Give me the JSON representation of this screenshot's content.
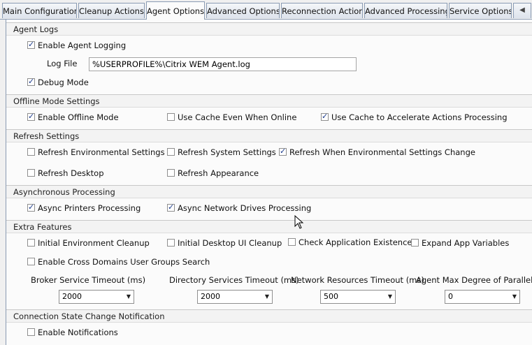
{
  "tabs": [
    {
      "label": "Main Configuration",
      "active": false
    },
    {
      "label": "Cleanup Actions",
      "active": false
    },
    {
      "label": "Agent Options",
      "active": true
    },
    {
      "label": "Advanced Options",
      "active": false
    },
    {
      "label": "Reconnection Actions",
      "active": false
    },
    {
      "label": "Advanced Processing",
      "active": false
    },
    {
      "label": "Service Options",
      "active": false
    }
  ],
  "tab_scroll_icon": "chevron-left-icon",
  "sections": {
    "agent_logs": {
      "title": "Agent Logs",
      "enable_agent_logging": {
        "label": "Enable Agent Logging",
        "checked": true
      },
      "log_file_label": "Log File",
      "log_file_value": "%USERPROFILE%\\Citrix WEM Agent.log",
      "debug_mode": {
        "label": "Debug Mode",
        "checked": true
      }
    },
    "offline_mode": {
      "title": "Offline Mode Settings",
      "enable_offline_mode": {
        "label": "Enable Offline Mode",
        "checked": true
      },
      "use_cache_online": {
        "label": "Use Cache Even When Online",
        "checked": false
      },
      "use_cache_accelerate": {
        "label": "Use Cache to Accelerate Actions Processing",
        "checked": true
      }
    },
    "refresh": {
      "title": "Refresh Settings",
      "refresh_env": {
        "label": "Refresh Environmental Settings",
        "checked": false
      },
      "refresh_system": {
        "label": "Refresh System Settings",
        "checked": false
      },
      "refresh_when_change": {
        "label": "Refresh When Environmental Settings Change",
        "checked": true
      },
      "refresh_desktop": {
        "label": "Refresh Desktop",
        "checked": false
      },
      "refresh_appearance": {
        "label": "Refresh Appearance",
        "checked": false
      }
    },
    "async": {
      "title": "Asynchronous Processing",
      "async_printers": {
        "label": "Async Printers Processing",
        "checked": true
      },
      "async_network_drives": {
        "label": "Async Network Drives Processing",
        "checked": true
      }
    },
    "extra": {
      "title": "Extra Features",
      "initial_env_cleanup": {
        "label": "Initial Environment Cleanup",
        "checked": false
      },
      "initial_desktop_cleanup": {
        "label": "Initial Desktop UI Cleanup",
        "checked": false
      },
      "check_app_existence": {
        "label": "Check Application Existence",
        "checked": false
      },
      "expand_app_variables": {
        "label": "Expand App Variables",
        "checked": false
      },
      "cross_domains": {
        "label": "Enable Cross Domains User Groups Search",
        "checked": false
      },
      "broker_timeout": {
        "label": "Broker Service Timeout  (ms)",
        "value": "2000"
      },
      "directory_timeout": {
        "label": "Directory Services Timeout  (ms)",
        "value": "2000"
      },
      "network_timeout": {
        "label": "Network Resources Timeout  (ms)",
        "value": "500"
      },
      "max_parallelism": {
        "label": "Agent Max Degree of Parallelism",
        "value": "0"
      }
    },
    "connection_state": {
      "title": "Connection State Change Notification",
      "enable_notifications": {
        "label": "Enable Notifications",
        "checked": false
      }
    }
  },
  "cursor_icon": "mouse-pointer-icon"
}
